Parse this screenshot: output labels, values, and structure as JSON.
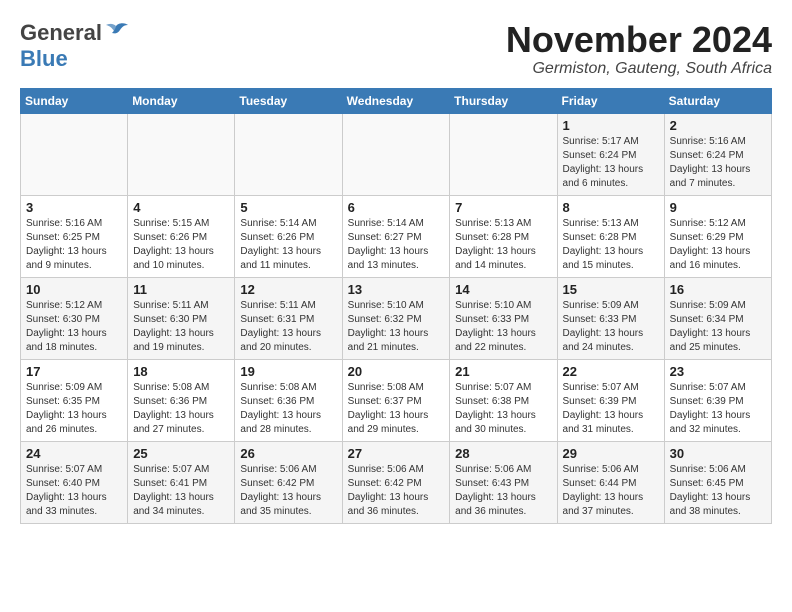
{
  "header": {
    "logo_general": "General",
    "logo_blue": "Blue",
    "title": "November 2024",
    "location": "Germiston, Gauteng, South Africa"
  },
  "days_of_week": [
    "Sunday",
    "Monday",
    "Tuesday",
    "Wednesday",
    "Thursday",
    "Friday",
    "Saturday"
  ],
  "weeks": [
    [
      {
        "day": "",
        "info": ""
      },
      {
        "day": "",
        "info": ""
      },
      {
        "day": "",
        "info": ""
      },
      {
        "day": "",
        "info": ""
      },
      {
        "day": "",
        "info": ""
      },
      {
        "day": "1",
        "info": "Sunrise: 5:17 AM\nSunset: 6:24 PM\nDaylight: 13 hours and 6 minutes."
      },
      {
        "day": "2",
        "info": "Sunrise: 5:16 AM\nSunset: 6:24 PM\nDaylight: 13 hours and 7 minutes."
      }
    ],
    [
      {
        "day": "3",
        "info": "Sunrise: 5:16 AM\nSunset: 6:25 PM\nDaylight: 13 hours and 9 minutes."
      },
      {
        "day": "4",
        "info": "Sunrise: 5:15 AM\nSunset: 6:26 PM\nDaylight: 13 hours and 10 minutes."
      },
      {
        "day": "5",
        "info": "Sunrise: 5:14 AM\nSunset: 6:26 PM\nDaylight: 13 hours and 11 minutes."
      },
      {
        "day": "6",
        "info": "Sunrise: 5:14 AM\nSunset: 6:27 PM\nDaylight: 13 hours and 13 minutes."
      },
      {
        "day": "7",
        "info": "Sunrise: 5:13 AM\nSunset: 6:28 PM\nDaylight: 13 hours and 14 minutes."
      },
      {
        "day": "8",
        "info": "Sunrise: 5:13 AM\nSunset: 6:28 PM\nDaylight: 13 hours and 15 minutes."
      },
      {
        "day": "9",
        "info": "Sunrise: 5:12 AM\nSunset: 6:29 PM\nDaylight: 13 hours and 16 minutes."
      }
    ],
    [
      {
        "day": "10",
        "info": "Sunrise: 5:12 AM\nSunset: 6:30 PM\nDaylight: 13 hours and 18 minutes."
      },
      {
        "day": "11",
        "info": "Sunrise: 5:11 AM\nSunset: 6:30 PM\nDaylight: 13 hours and 19 minutes."
      },
      {
        "day": "12",
        "info": "Sunrise: 5:11 AM\nSunset: 6:31 PM\nDaylight: 13 hours and 20 minutes."
      },
      {
        "day": "13",
        "info": "Sunrise: 5:10 AM\nSunset: 6:32 PM\nDaylight: 13 hours and 21 minutes."
      },
      {
        "day": "14",
        "info": "Sunrise: 5:10 AM\nSunset: 6:33 PM\nDaylight: 13 hours and 22 minutes."
      },
      {
        "day": "15",
        "info": "Sunrise: 5:09 AM\nSunset: 6:33 PM\nDaylight: 13 hours and 24 minutes."
      },
      {
        "day": "16",
        "info": "Sunrise: 5:09 AM\nSunset: 6:34 PM\nDaylight: 13 hours and 25 minutes."
      }
    ],
    [
      {
        "day": "17",
        "info": "Sunrise: 5:09 AM\nSunset: 6:35 PM\nDaylight: 13 hours and 26 minutes."
      },
      {
        "day": "18",
        "info": "Sunrise: 5:08 AM\nSunset: 6:36 PM\nDaylight: 13 hours and 27 minutes."
      },
      {
        "day": "19",
        "info": "Sunrise: 5:08 AM\nSunset: 6:36 PM\nDaylight: 13 hours and 28 minutes."
      },
      {
        "day": "20",
        "info": "Sunrise: 5:08 AM\nSunset: 6:37 PM\nDaylight: 13 hours and 29 minutes."
      },
      {
        "day": "21",
        "info": "Sunrise: 5:07 AM\nSunset: 6:38 PM\nDaylight: 13 hours and 30 minutes."
      },
      {
        "day": "22",
        "info": "Sunrise: 5:07 AM\nSunset: 6:39 PM\nDaylight: 13 hours and 31 minutes."
      },
      {
        "day": "23",
        "info": "Sunrise: 5:07 AM\nSunset: 6:39 PM\nDaylight: 13 hours and 32 minutes."
      }
    ],
    [
      {
        "day": "24",
        "info": "Sunrise: 5:07 AM\nSunset: 6:40 PM\nDaylight: 13 hours and 33 minutes."
      },
      {
        "day": "25",
        "info": "Sunrise: 5:07 AM\nSunset: 6:41 PM\nDaylight: 13 hours and 34 minutes."
      },
      {
        "day": "26",
        "info": "Sunrise: 5:06 AM\nSunset: 6:42 PM\nDaylight: 13 hours and 35 minutes."
      },
      {
        "day": "27",
        "info": "Sunrise: 5:06 AM\nSunset: 6:42 PM\nDaylight: 13 hours and 36 minutes."
      },
      {
        "day": "28",
        "info": "Sunrise: 5:06 AM\nSunset: 6:43 PM\nDaylight: 13 hours and 36 minutes."
      },
      {
        "day": "29",
        "info": "Sunrise: 5:06 AM\nSunset: 6:44 PM\nDaylight: 13 hours and 37 minutes."
      },
      {
        "day": "30",
        "info": "Sunrise: 5:06 AM\nSunset: 6:45 PM\nDaylight: 13 hours and 38 minutes."
      }
    ]
  ]
}
